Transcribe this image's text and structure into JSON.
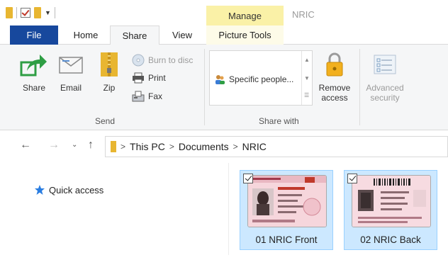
{
  "title_bar": {
    "contextual_tab_header": "Manage",
    "window_title": "NRIC"
  },
  "tabs": [
    {
      "label": "File"
    },
    {
      "label": "Home"
    },
    {
      "label": "Share",
      "active": true
    },
    {
      "label": "View"
    },
    {
      "label": "Picture Tools"
    }
  ],
  "ribbon": {
    "send": {
      "label": "Send",
      "share": "Share",
      "email": "Email",
      "zip": "Zip",
      "burn_to_disc": "Burn to disc",
      "print": "Print",
      "fax": "Fax"
    },
    "share_with": {
      "label": "Share with",
      "gallery_item": "Specific people...",
      "remove_access": [
        "Remove",
        "access"
      ],
      "advanced_security": [
        "Advanced",
        "security"
      ]
    }
  },
  "address_bar": {
    "breadcrumbs": [
      "This PC",
      "Documents",
      "NRIC"
    ]
  },
  "nav_pane": {
    "quick_access": "Quick access"
  },
  "files": [
    {
      "name": "01 NRIC Front",
      "selected": true,
      "checked": true
    },
    {
      "name": "02 NRIC Back",
      "selected": true,
      "checked": true
    }
  ],
  "colors": {
    "file_tab": "#17489d",
    "manage_header": "#faf1a7",
    "selection": "#cce8ff",
    "selection_border": "#99d1ff",
    "folder": "#e8b631"
  }
}
